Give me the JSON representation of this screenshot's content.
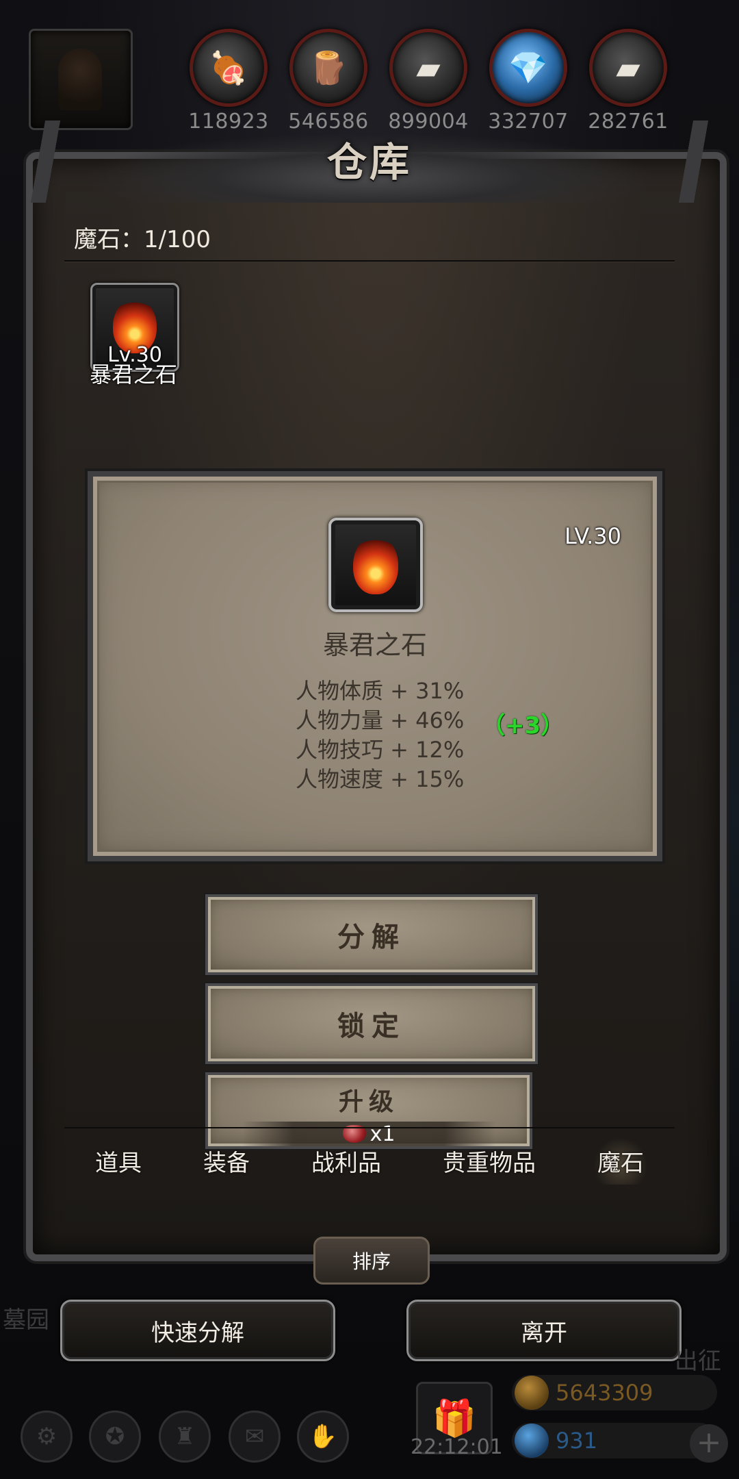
{
  "resources": [
    {
      "icon": "meat-icon",
      "amount": "118923"
    },
    {
      "icon": "wood-icon",
      "amount": "546586"
    },
    {
      "icon": "iron-icon",
      "amount": "899004"
    },
    {
      "icon": "crystal-icon",
      "amount": "332707"
    },
    {
      "icon": "stone-icon",
      "amount": "282761"
    }
  ],
  "window": {
    "title": "仓库"
  },
  "inventory": {
    "count_label": "魔石：1/100"
  },
  "items": [
    {
      "level": "Lv.30",
      "name": "暴君之石"
    }
  ],
  "detail": {
    "level": "LV.30",
    "name": "暴君之石",
    "stats": [
      "人物体质 + 31%",
      "人物力量 + 46%",
      "人物技巧 + 12%",
      "人物速度 + 15%"
    ],
    "bonus": "（+3）"
  },
  "actions": {
    "decompose": "分解",
    "lock": "锁定",
    "upgrade": "升级",
    "upgrade_cost": "x1"
  },
  "tabs": [
    {
      "label": "道具",
      "active": false
    },
    {
      "label": "装备",
      "active": false
    },
    {
      "label": "战利品",
      "active": false
    },
    {
      "label": "贵重物品",
      "active": false
    },
    {
      "label": "魔石",
      "active": true
    }
  ],
  "footer": {
    "sort": "排序",
    "quick_decompose": "快速分解",
    "leave": "离开"
  },
  "hud": {
    "left_label": "墓园",
    "right_label": "出征",
    "clock": "22:12:01",
    "gold": "5643309",
    "gems": "931"
  },
  "colors": {
    "bonus_green": "#2bd62b",
    "card_parchment": "#8f8474",
    "gold_text": "#7a5a22",
    "gem_text": "#2a5a8a"
  }
}
